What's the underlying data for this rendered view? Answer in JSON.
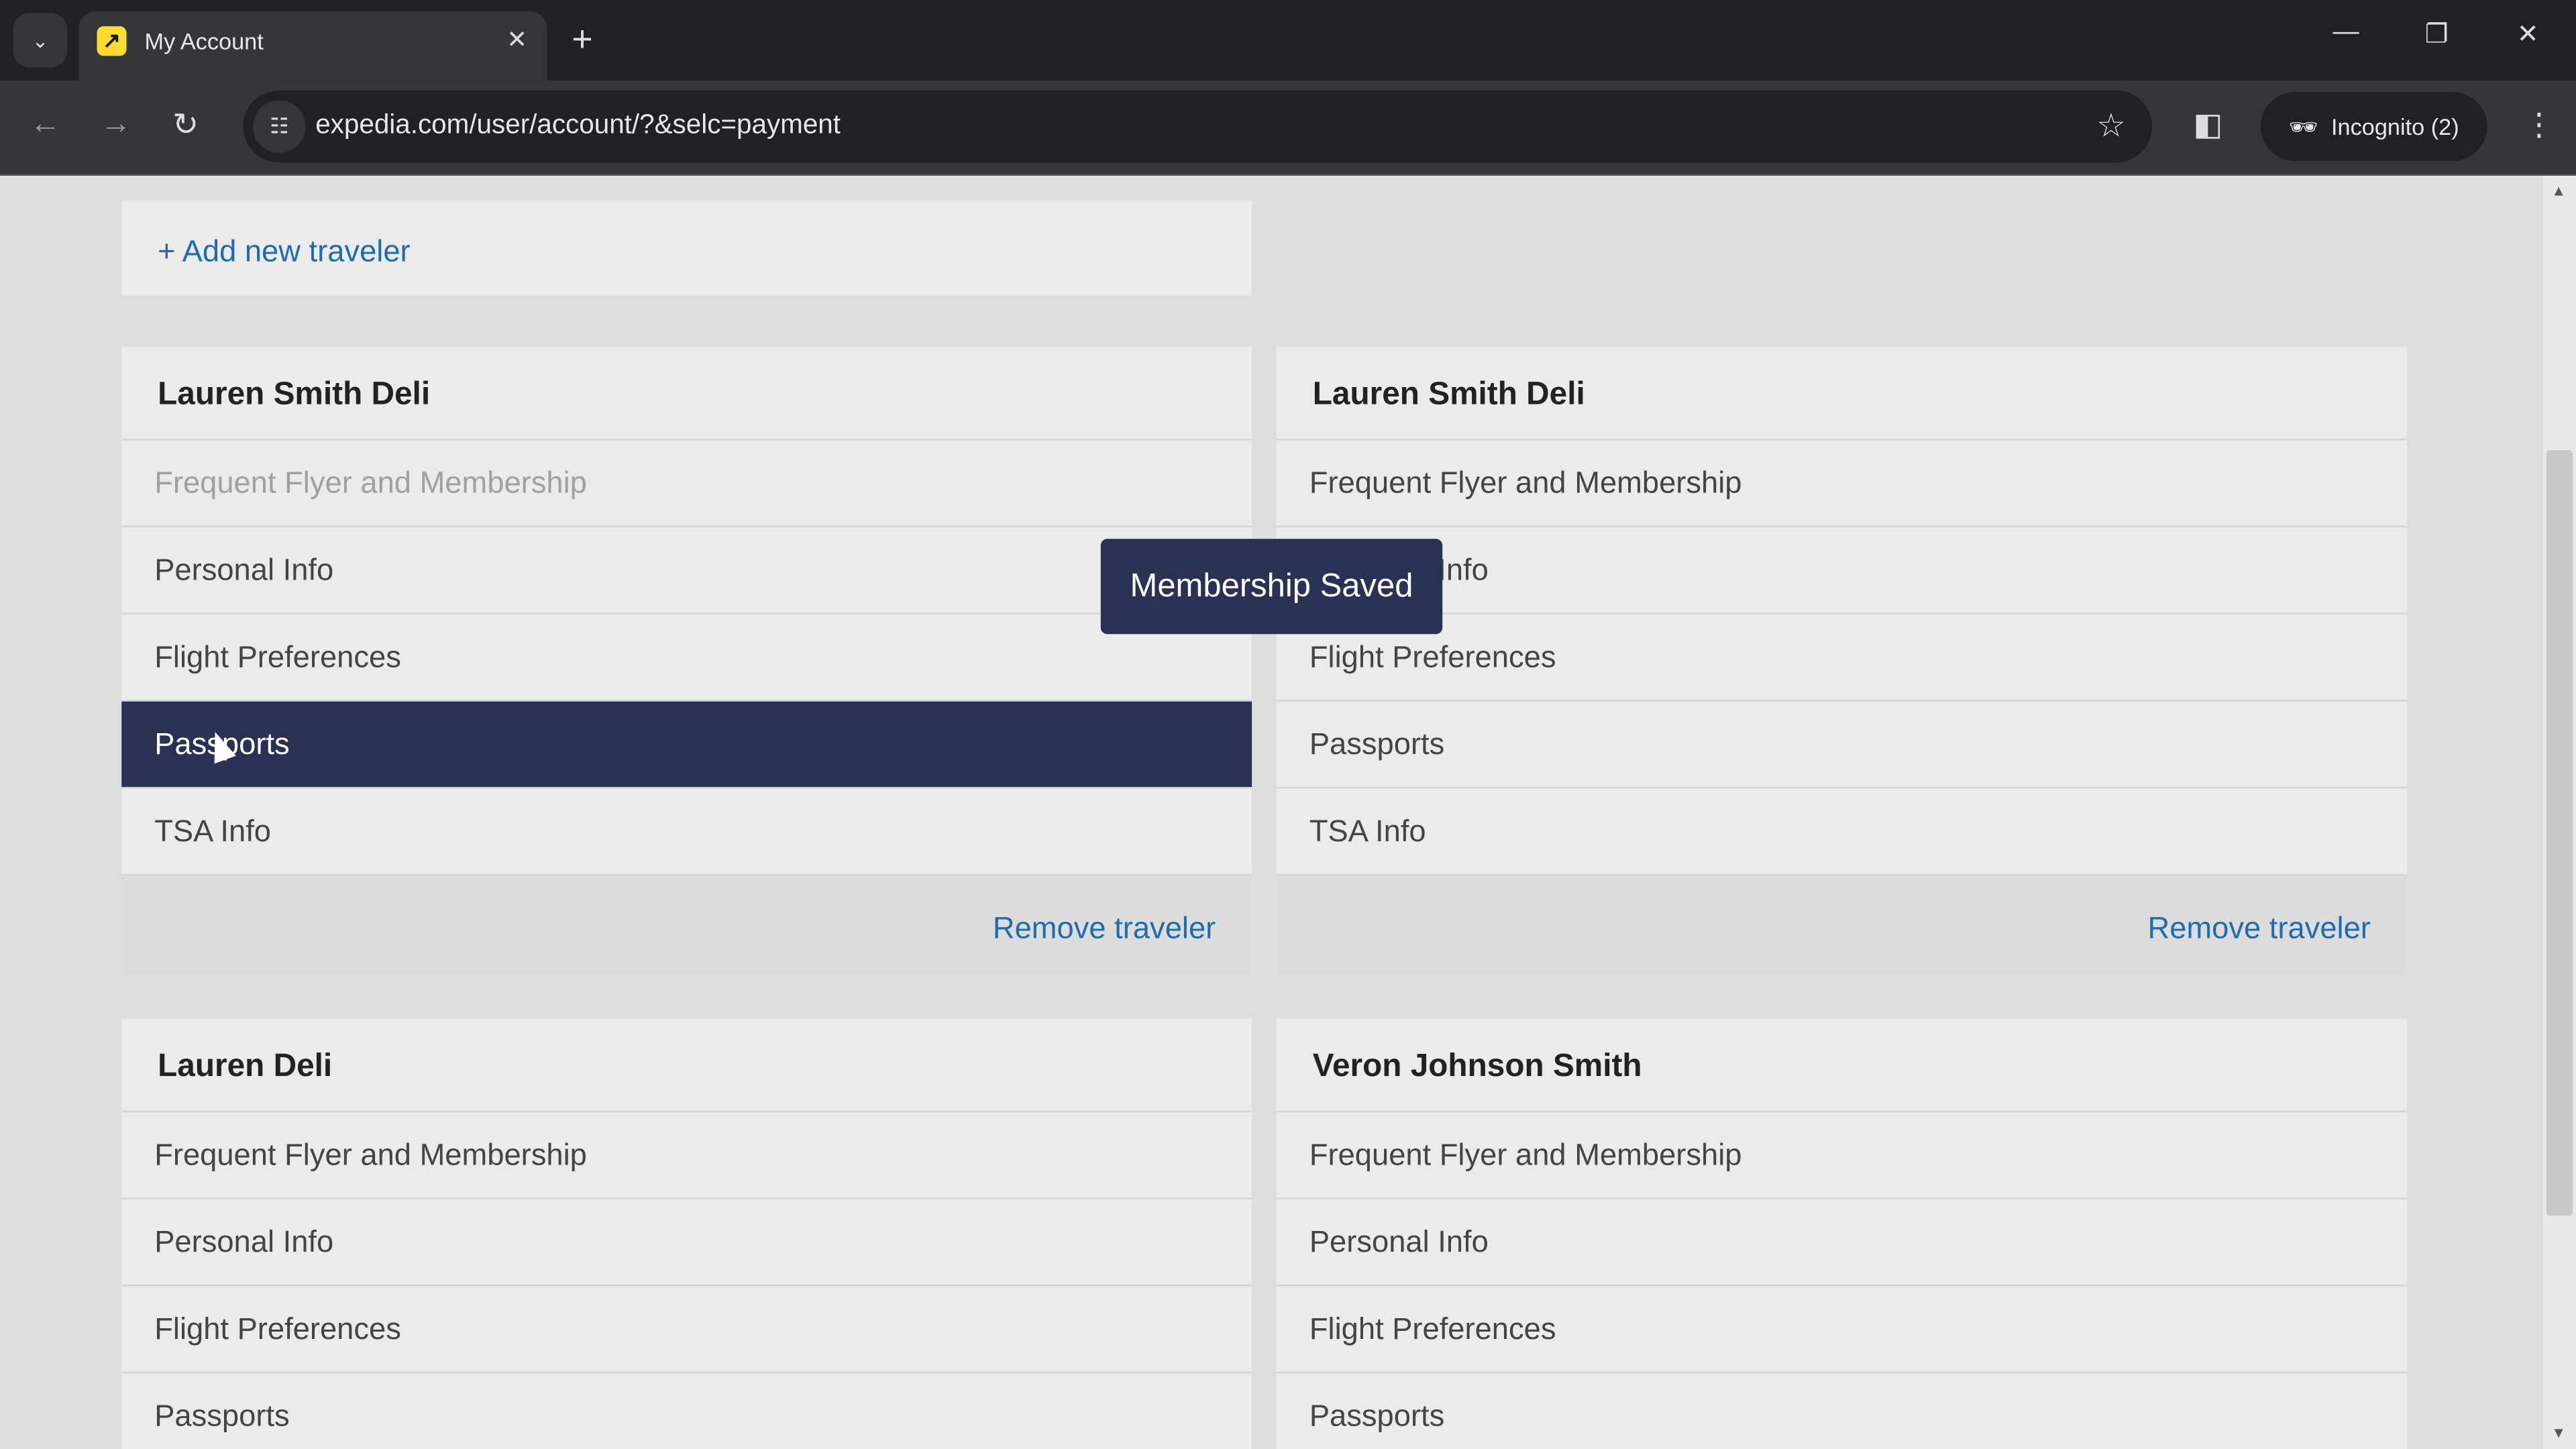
{
  "browser": {
    "tab_title": "My Account",
    "url": "expedia.com/user/account/?&selc=payment",
    "incognito_label": "Incognito (2)",
    "favicon_color": "#fddb32"
  },
  "page": {
    "add_traveler_label": "+ Add new traveler",
    "toast": "Membership Saved",
    "accent_color": "#2a3152",
    "link_color": "#1f6bb0",
    "cards": [
      {
        "name": "Lauren Smith Deli",
        "items": [
          "Frequent Flyer and Membership",
          "Personal Info",
          "Flight Preferences",
          "Passports",
          "TSA Info"
        ],
        "muted": 0,
        "active": 3,
        "footer": "Remove traveler"
      },
      {
        "name": "Lauren Smith Deli",
        "items": [
          "Frequent Flyer and Membership",
          "Personal Info",
          "Flight Preferences",
          "Passports",
          "TSA Info"
        ],
        "footer": "Remove traveler"
      },
      {
        "name": "Lauren Deli",
        "items": [
          "Frequent Flyer and Membership",
          "Personal Info",
          "Flight Preferences",
          "Passports"
        ]
      },
      {
        "name": "Veron Johnson Smith",
        "items": [
          "Frequent Flyer and Membership",
          "Personal Info",
          "Flight Preferences",
          "Passports"
        ]
      }
    ]
  }
}
